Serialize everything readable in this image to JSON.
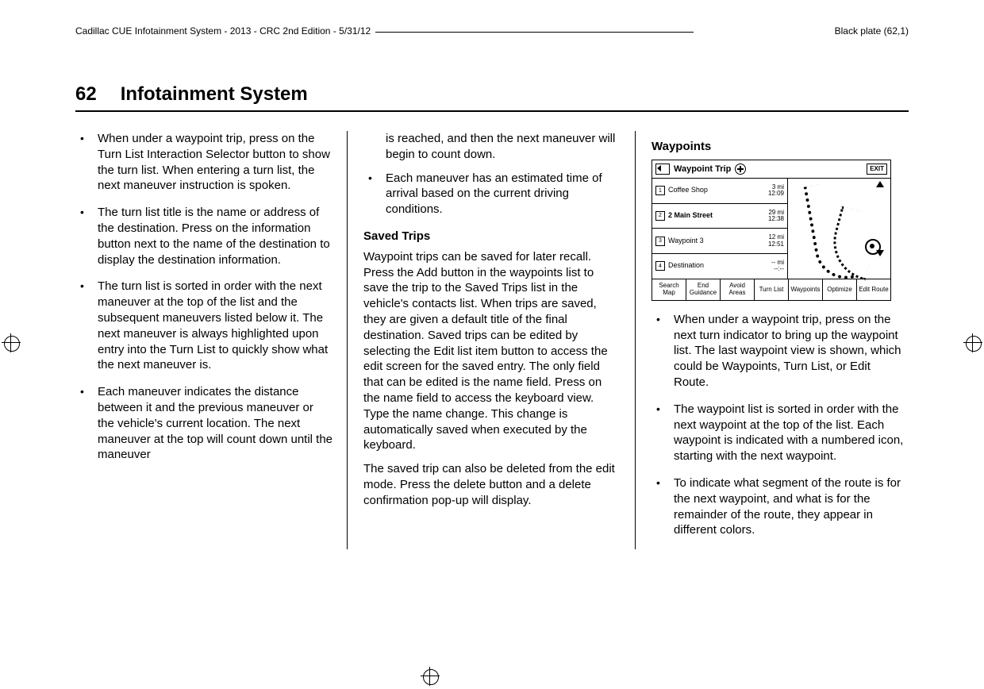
{
  "meta": {
    "doc_header": "Cadillac CUE Infotainment System - 2013 - CRC 2nd Edition - 5/31/12",
    "plate": "Black plate (62,1)"
  },
  "header": {
    "page_num": "62",
    "title": "Infotainment System"
  },
  "col1": {
    "items": [
      "When under a waypoint trip, press on the Turn List Interaction Selector button to show the turn list. When entering a turn list, the next maneuver instruction is spoken.",
      "The turn list title is the name or address of the destination. Press on the information button next to the name of the destination to display the destination information.",
      "The turn list is sorted in order with the next maneuver at the top of the list and the subsequent maneuvers listed below it. The next maneuver is always highlighted upon entry into the Turn List to quickly show what the next maneuver is.",
      "Each maneuver indicates the distance between it and the previous maneuver or the vehicle's current location. The next maneuver at the top will count down until the maneuver"
    ]
  },
  "col2": {
    "cont": "is reached, and then the next maneuver will begin to count down.",
    "item": "Each maneuver has an estimated time of arrival based on the current driving conditions.",
    "saved_h": "Saved Trips",
    "saved_p1": "Waypoint trips can be saved for later recall. Press the Add button in the waypoints list to save the trip to the Saved Trips list in the vehicle's contacts list. When trips are saved, they are given a default title of the final destination. Saved trips can be edited by selecting the Edit list item button to access the edit screen for the saved entry. The only field that can be edited is the name field. Press on the name field to access the keyboard view. Type the name change. This change is automatically saved when executed by the keyboard.",
    "saved_p2": "The saved trip can also be deleted from the edit mode. Press the delete button and a delete confirmation pop-up will display."
  },
  "col3": {
    "wp_h": "Waypoints",
    "items": [
      "When under a waypoint trip, press on the next turn indicator to bring up the waypoint list. The last waypoint view is shown, which could be Waypoints, Turn List, or Edit Route.",
      "The waypoint list is sorted in order with the next waypoint at the top of the list. Each waypoint is indicated with a numbered icon, starting with the next waypoint.",
      "To indicate what segment of the route is for the next waypoint, and what is for the remainder of the route, they appear in different colors."
    ]
  },
  "ui": {
    "title": "Waypoint Trip",
    "exit": "EXIT",
    "rows": [
      {
        "n": "1",
        "name": "Coffee Shop",
        "dist": "3 mi",
        "time": "12:09"
      },
      {
        "n": "2",
        "name": "2 Main Street",
        "dist": "29 mi",
        "time": "12:38"
      },
      {
        "n": "3",
        "name": "Waypoint 3",
        "dist": "12 mi",
        "time": "12:51"
      },
      {
        "n": "4",
        "name": "Destination",
        "dist": "-- mi",
        "time": "--:--"
      }
    ],
    "buttons": [
      "Search Map",
      "End Guidance",
      "Avoid Areas",
      "Turn List",
      "Waypoints",
      "Optimize",
      "Edit Route"
    ]
  }
}
